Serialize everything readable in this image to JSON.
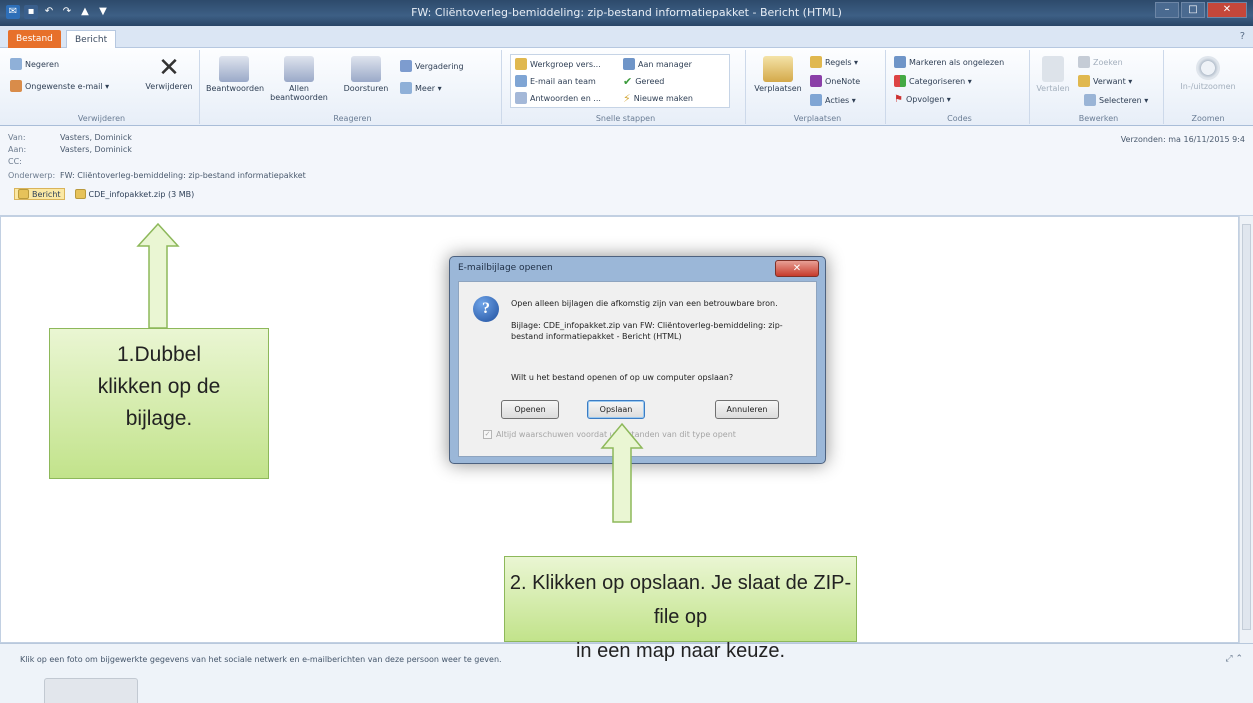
{
  "window": {
    "title": "FW: Cliëntoverleg-bemiddeling: zip-bestand informatiepakket - Bericht (HTML)",
    "minimize": "–",
    "maximize": "□",
    "close": "✕"
  },
  "tabs": {
    "file": "Bestand",
    "message": "Bericht",
    "help": "?"
  },
  "ribbon": {
    "delete_group": {
      "label": "Verwijderen",
      "ignore": "Negeren",
      "junk": "Ongewenste e-mail ▾",
      "delete": "Verwijderen"
    },
    "respond_group": {
      "label": "Reageren",
      "reply": "Beantwoorden",
      "reply_all": "Allen beantwoorden",
      "forward": "Doorsturen",
      "meeting": "Vergadering",
      "more": "Meer ▾"
    },
    "quicksteps_group": {
      "label": "Snelle stappen",
      "items": [
        "Werkgroep vers...",
        "E-mail aan team",
        "Antwoorden en ...",
        "Aan manager",
        "Gereed",
        "Nieuwe maken"
      ]
    },
    "move_group": {
      "label": "Verplaatsen",
      "move": "Verplaatsen",
      "rules": "Regels ▾",
      "onenote": "OneNote",
      "actions": "Acties ▾"
    },
    "tags_group": {
      "label": "Codes",
      "unread": "Markeren als ongelezen",
      "categorize": "Categoriseren ▾",
      "followup": "Opvolgen ▾"
    },
    "edit_group": {
      "label": "Bewerken",
      "translate": "Vertalen",
      "find": "Zoeken",
      "related": "Verwant ▾",
      "select": "Selecteren ▾"
    },
    "zoom_group": {
      "label": "Zoomen",
      "zoom": "In-/uitzoomen"
    }
  },
  "header": {
    "from_label": "Van:",
    "from": "Vasters, Dominick",
    "to_label": "Aan:",
    "to": "Vasters, Dominick",
    "cc_label": "CC:",
    "cc": "",
    "subject_label": "Onderwerp:",
    "subject": "FW: Cliëntoverleg-bemiddeling: zip-bestand informatiepakket",
    "sent_label": "Verzonden:",
    "sent": "ma 16/11/2015 9:4",
    "attachments": [
      "Bericht",
      "CDE_infopakket.zip (3 MB)"
    ]
  },
  "people_pane": {
    "text": "Klik op een foto om bijgewerkte gegevens van het sociale netwerk en e-mailberichten van deze persoon weer te geven.",
    "controls": "⤢ ⌃"
  },
  "dialog": {
    "title": "E-mailbijlage openen",
    "close": "✕",
    "warning": "Open alleen bijlagen die afkomstig zijn van een betrouwbare bron.",
    "attachment_info": "Bijlage: CDE_infopakket.zip van FW: Cliëntoverleg-bemiddeling: zip-bestand informatiepakket - Bericht (HTML)",
    "question": "Wilt u het bestand openen of op uw computer opslaan?",
    "open": "Openen",
    "save": "Opslaan",
    "cancel": "Annuleren",
    "checkbox": "Altijd waarschuwen voordat u bestanden van dit type opent"
  },
  "callouts": {
    "step1_lines": [
      "1.Dubbel",
      "klikken op de",
      "bijlage."
    ],
    "step2_lines": [
      "2. Klikken op opslaan. Je slaat de ZIP-file op",
      "in een map naar keuze."
    ]
  },
  "colors": {
    "callout_fill": "#d6edb0",
    "callout_border": "#8db85a",
    "file_tab": "#e7702a"
  }
}
